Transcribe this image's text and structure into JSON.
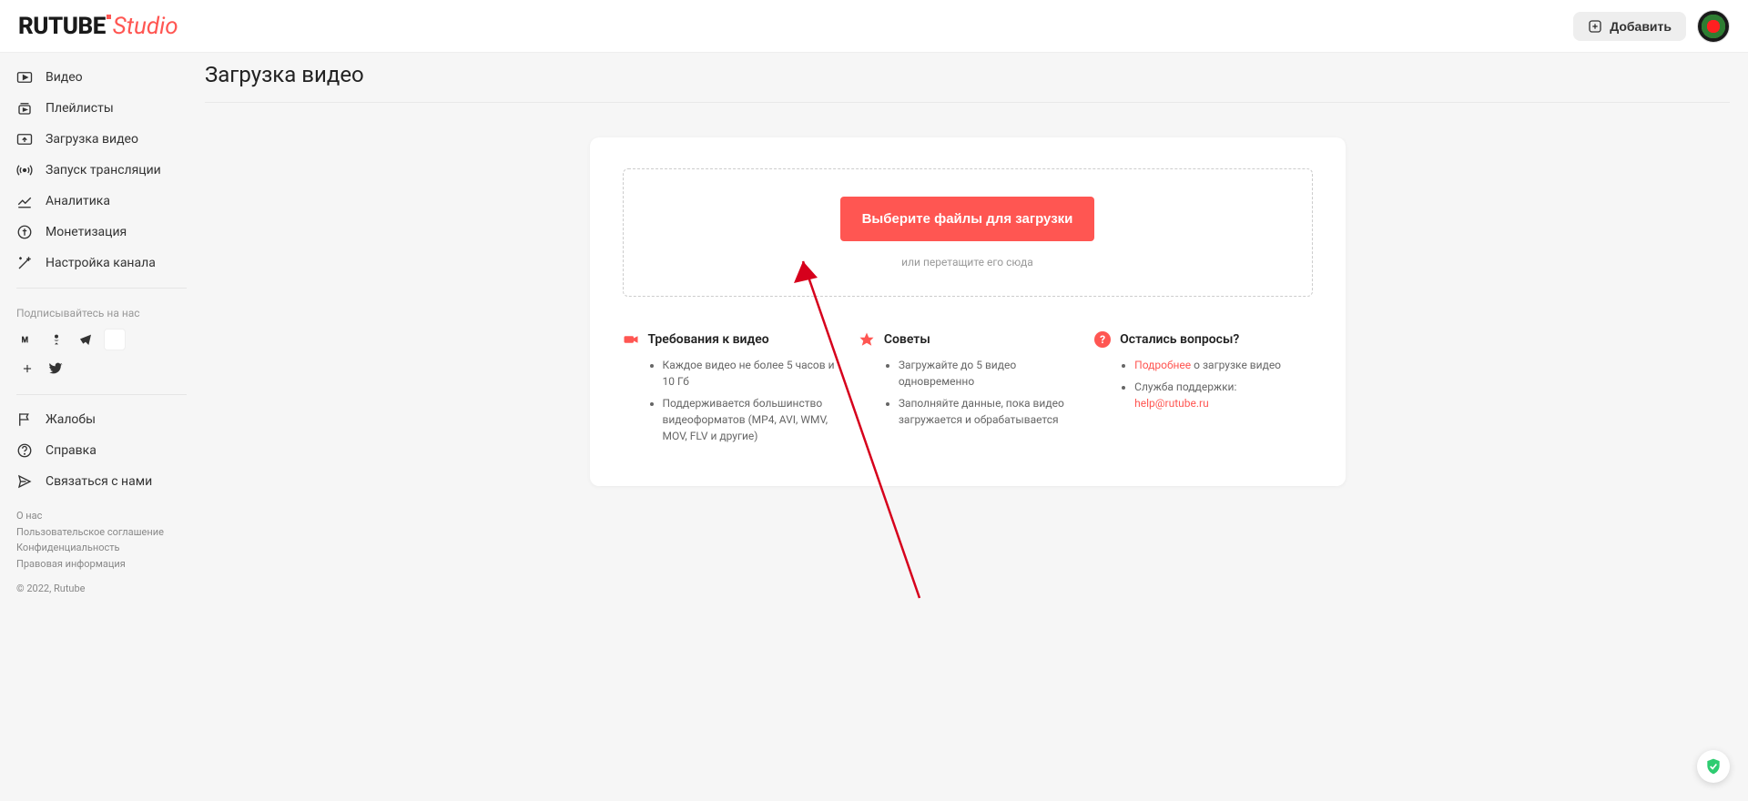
{
  "header": {
    "logo_primary": "RUTUBE",
    "logo_secondary": "Studio",
    "add_button_label": "Добавить"
  },
  "sidebar": {
    "nav": [
      {
        "label": "Видео"
      },
      {
        "label": "Плейлисты"
      },
      {
        "label": "Загрузка видео"
      },
      {
        "label": "Запуск трансляции"
      },
      {
        "label": "Аналитика"
      },
      {
        "label": "Монетизация"
      },
      {
        "label": "Настройка канала"
      }
    ],
    "subscribe_label": "Подписывайтесь на нас",
    "support": [
      {
        "label": "Жалобы"
      },
      {
        "label": "Справка"
      },
      {
        "label": "Связаться с нами"
      }
    ],
    "footer_links": [
      "О нас",
      "Пользовательское соглашение",
      "Конфиденциальность",
      "Правовая информация"
    ],
    "copyright": "© 2022, Rutube"
  },
  "page": {
    "title": "Загрузка видео",
    "upload": {
      "select_button": "Выберите файлы для загрузки",
      "drag_hint": "или перетащите его сюда"
    },
    "info_columns": {
      "requirements": {
        "title": "Требования к видео",
        "items": [
          "Каждое видео не более 5 часов и 10 Гб",
          "Поддерживается большинство видеоформатов (MP4, AVI, WMV, MOV, FLV и другие)"
        ]
      },
      "tips": {
        "title": "Советы",
        "items": [
          "Загружайте до 5 видео одновременно",
          "Заполняйте данные, пока видео загружается и обрабатывается"
        ]
      },
      "questions": {
        "title": "Остались вопросы?",
        "more_link_text": "Подробнее",
        "more_suffix": " о загрузке видео",
        "support_label": "Служба поддержки:",
        "support_email": "help@rutube.ru"
      }
    }
  }
}
